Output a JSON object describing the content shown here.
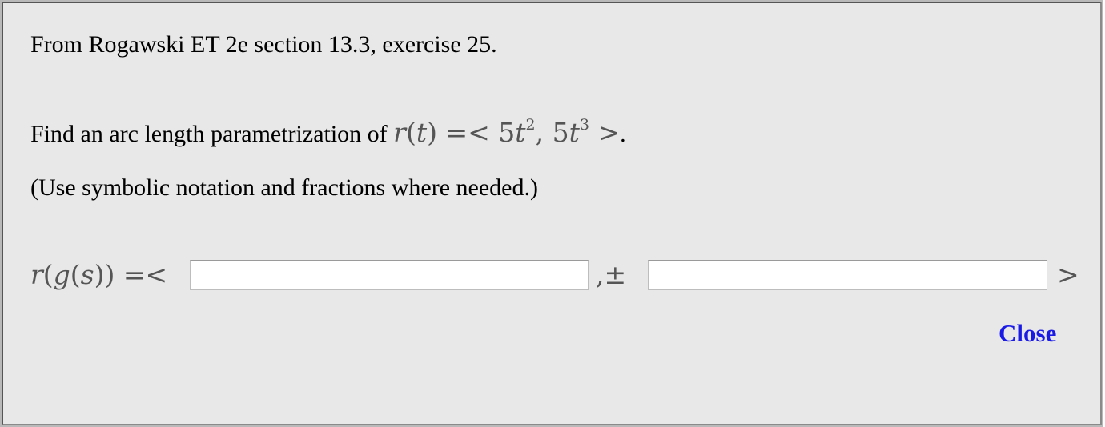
{
  "source_line": "From Rogawski ET 2e section 13.3, exercise 25.",
  "prompt": {
    "text": "Find an arc length parametrization of",
    "math_lhs": "r",
    "math_open": "(",
    "math_var": "t",
    "math_close": ")",
    "math_eq": "=<",
    "comp1_coef": "5",
    "comp1_var": "t",
    "comp1_exp": "2",
    "comma": ",",
    "comp2_coef": "5",
    "comp2_var": "t",
    "comp2_exp": "3",
    "math_end": ">",
    "period": "."
  },
  "note": "(Use symbolic notation and fractions where needed.)",
  "answer": {
    "label_r": "r",
    "label_open": "(",
    "label_g": "g",
    "label_open2": "(",
    "label_s": "s",
    "label_close": "))",
    "label_eq": "=<",
    "input1_value": "",
    "separator": ",±",
    "input2_value": "",
    "closer": ">"
  },
  "close_label": "Close"
}
